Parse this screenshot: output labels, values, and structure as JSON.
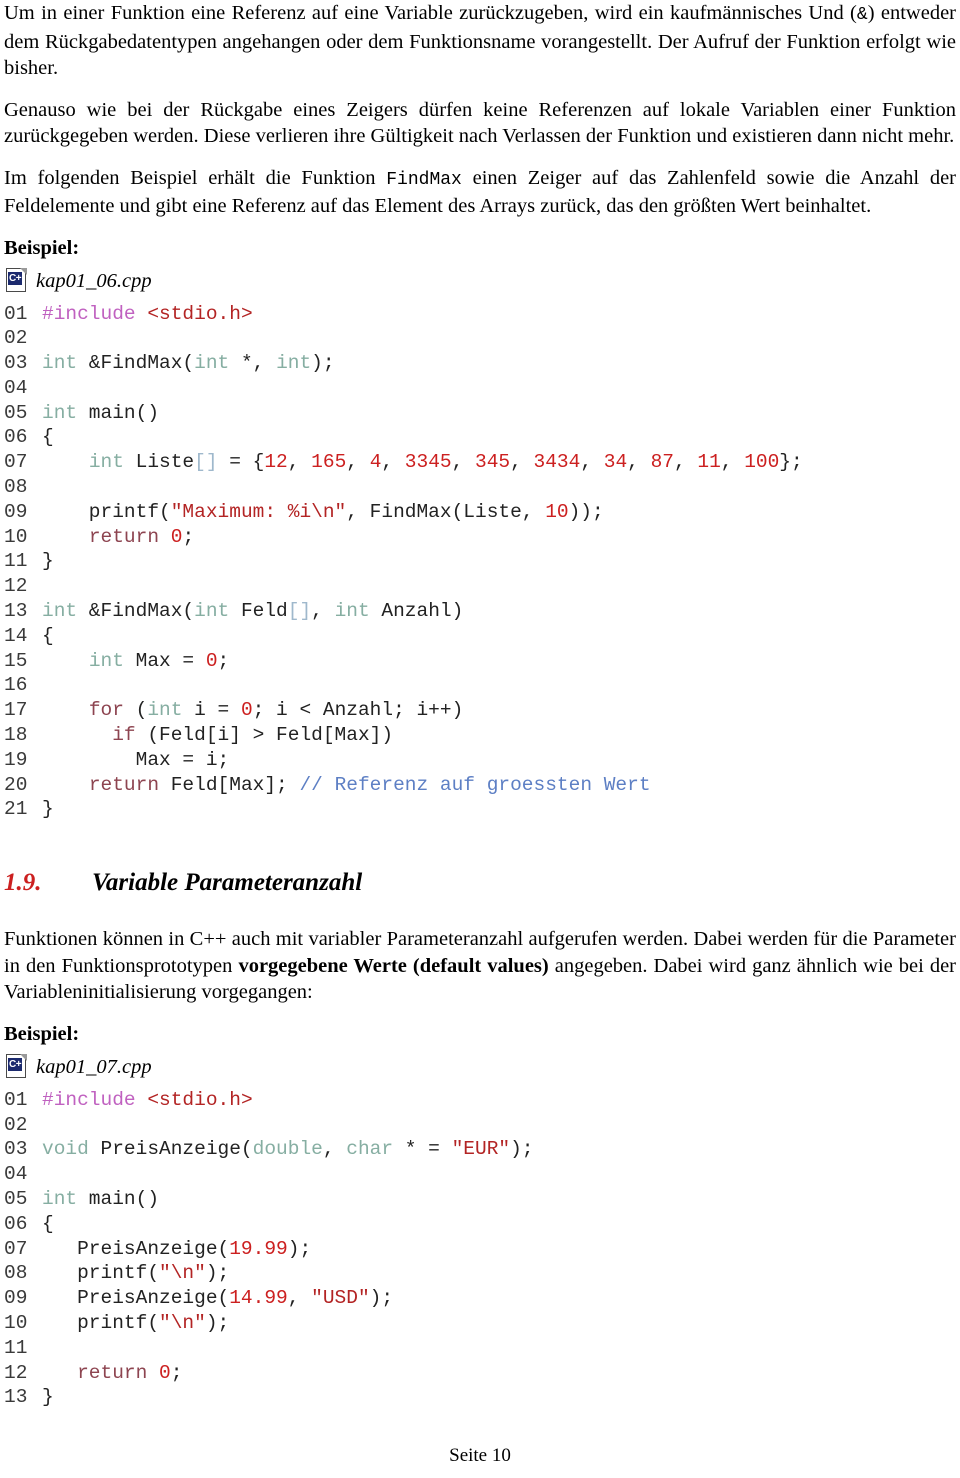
{
  "document": {
    "language": "de",
    "page_footer": "Seite 10"
  },
  "colors": {
    "text": "#000000",
    "code_default": "#222222",
    "line_number": "#3a3a3a",
    "keyword": "#8d4450",
    "type": "#86aea2",
    "preprocessor": "#c061c0",
    "string": "#b32424",
    "number": "#cc2020",
    "comment": "#5d7fc4",
    "icon_badge": "#1c2a6e"
  },
  "paragraphs": {
    "p1_part1": "Um in einer Funktion eine Referenz auf eine Variable zurückzugeben, wird ein kaufmännisches Und (",
    "p1_amp": "&",
    "p1_part2": ") entweder dem Rückgabedatentypen angehangen oder dem Funktionsname vorangestellt. Der Aufruf der Funktion erfolgt wie bisher.",
    "p2": "Genauso wie bei der Rückgabe eines Zeigers dürfen keine Referenzen auf lokale Variablen einer Funktion zurückgegeben werden. Diese verlieren ihre Gültigkeit nach Verlassen der Funktion und existieren dann nicht mehr.",
    "p3_part1": "Im folgenden Beispiel erhält die Funktion ",
    "p3_code": "FindMax",
    "p3_part2": " einen Zeiger auf das Zahlenfeld sowie die Anzahl der Feldelemente und gibt eine Referenz auf das Element des Arrays zurück, das den größten Wert beinhaltet.",
    "p4_part1": "Funktionen können in C++ auch mit variabler Parameteranzahl aufgerufen werden. Dabei werden für die Parameter in den Funktionsprototypen ",
    "p4_bold": "vorgegebene Werte (default values)",
    "p4_part2": " angegeben. Dabei wird ganz ähnlich wie bei der Variableninitialisierung vorgegangen:"
  },
  "labels": {
    "beispiel_1": "Beispiel:",
    "beispiel_2": "Beispiel:"
  },
  "section": {
    "number": "1.9.",
    "title": "Variable Parameteranzahl"
  },
  "listing1": {
    "icon": "cpp-file-icon",
    "icon_badge_text": "C+",
    "filename": "kap01_06.cpp",
    "lines": [
      {
        "n": "01",
        "tokens": [
          {
            "t": "#include ",
            "c": "pre"
          },
          {
            "t": "<stdio.h>",
            "c": "str"
          }
        ]
      },
      {
        "n": "02",
        "tokens": []
      },
      {
        "n": "03",
        "tokens": [
          {
            "t": "int",
            "c": "type"
          },
          {
            "t": " &FindMax(",
            "c": "plain"
          },
          {
            "t": "int",
            "c": "type"
          },
          {
            "t": " *, ",
            "c": "plain"
          },
          {
            "t": "int",
            "c": "type"
          },
          {
            "t": ");",
            "c": "plain"
          }
        ]
      },
      {
        "n": "04",
        "tokens": []
      },
      {
        "n": "05",
        "tokens": [
          {
            "t": "int",
            "c": "type"
          },
          {
            "t": " main()",
            "c": "plain"
          }
        ]
      },
      {
        "n": "06",
        "tokens": [
          {
            "t": "{",
            "c": "plain"
          }
        ]
      },
      {
        "n": "07",
        "tokens": [
          {
            "t": "    ",
            "c": "plain"
          },
          {
            "t": "int",
            "c": "type"
          },
          {
            "t": " Liste",
            "c": "plain"
          },
          {
            "t": "[]",
            "c": "pun"
          },
          {
            "t": " = {",
            "c": "plain"
          },
          {
            "t": "12",
            "c": "num"
          },
          {
            "t": ", ",
            "c": "plain"
          },
          {
            "t": "165",
            "c": "num"
          },
          {
            "t": ", ",
            "c": "plain"
          },
          {
            "t": "4",
            "c": "num"
          },
          {
            "t": ", ",
            "c": "plain"
          },
          {
            "t": "3345",
            "c": "num"
          },
          {
            "t": ", ",
            "c": "plain"
          },
          {
            "t": "345",
            "c": "num"
          },
          {
            "t": ", ",
            "c": "plain"
          },
          {
            "t": "3434",
            "c": "num"
          },
          {
            "t": ", ",
            "c": "plain"
          },
          {
            "t": "34",
            "c": "num"
          },
          {
            "t": ", ",
            "c": "plain"
          },
          {
            "t": "87",
            "c": "num"
          },
          {
            "t": ", ",
            "c": "plain"
          },
          {
            "t": "11",
            "c": "num"
          },
          {
            "t": ", ",
            "c": "plain"
          },
          {
            "t": "100",
            "c": "num"
          },
          {
            "t": "};",
            "c": "plain"
          }
        ]
      },
      {
        "n": "08",
        "tokens": []
      },
      {
        "n": "09",
        "tokens": [
          {
            "t": "    printf(",
            "c": "plain"
          },
          {
            "t": "\"Maximum: %i\\n\"",
            "c": "str"
          },
          {
            "t": ", FindMax(Liste, ",
            "c": "plain"
          },
          {
            "t": "10",
            "c": "num"
          },
          {
            "t": "));",
            "c": "plain"
          }
        ]
      },
      {
        "n": "10",
        "tokens": [
          {
            "t": "    ",
            "c": "plain"
          },
          {
            "t": "return",
            "c": "kw"
          },
          {
            "t": " ",
            "c": "plain"
          },
          {
            "t": "0",
            "c": "num"
          },
          {
            "t": ";",
            "c": "plain"
          }
        ]
      },
      {
        "n": "11",
        "tokens": [
          {
            "t": "}",
            "c": "plain"
          }
        ]
      },
      {
        "n": "12",
        "tokens": []
      },
      {
        "n": "13",
        "tokens": [
          {
            "t": "int",
            "c": "type"
          },
          {
            "t": " &FindMax(",
            "c": "plain"
          },
          {
            "t": "int",
            "c": "type"
          },
          {
            "t": " Feld",
            "c": "plain"
          },
          {
            "t": "[]",
            "c": "pun"
          },
          {
            "t": ", ",
            "c": "plain"
          },
          {
            "t": "int",
            "c": "type"
          },
          {
            "t": " Anzahl)",
            "c": "plain"
          }
        ]
      },
      {
        "n": "14",
        "tokens": [
          {
            "t": "{",
            "c": "plain"
          }
        ]
      },
      {
        "n": "15",
        "tokens": [
          {
            "t": "    ",
            "c": "plain"
          },
          {
            "t": "int",
            "c": "type"
          },
          {
            "t": " Max = ",
            "c": "plain"
          },
          {
            "t": "0",
            "c": "num"
          },
          {
            "t": ";",
            "c": "plain"
          }
        ]
      },
      {
        "n": "16",
        "tokens": []
      },
      {
        "n": "17",
        "tokens": [
          {
            "t": "    ",
            "c": "plain"
          },
          {
            "t": "for",
            "c": "kw"
          },
          {
            "t": " (",
            "c": "plain"
          },
          {
            "t": "int",
            "c": "type"
          },
          {
            "t": " i = ",
            "c": "plain"
          },
          {
            "t": "0",
            "c": "num"
          },
          {
            "t": "; i < Anzahl; i++)",
            "c": "plain"
          }
        ]
      },
      {
        "n": "18",
        "tokens": [
          {
            "t": "      ",
            "c": "plain"
          },
          {
            "t": "if",
            "c": "kw"
          },
          {
            "t": " (Feld[i] > Feld[Max])",
            "c": "plain"
          }
        ]
      },
      {
        "n": "19",
        "tokens": [
          {
            "t": "        Max = i;",
            "c": "plain"
          }
        ]
      },
      {
        "n": "20",
        "tokens": [
          {
            "t": "    ",
            "c": "plain"
          },
          {
            "t": "return",
            "c": "kw"
          },
          {
            "t": " Feld[Max]; ",
            "c": "plain"
          },
          {
            "t": "// Referenz auf groessten Wert",
            "c": "com"
          }
        ]
      },
      {
        "n": "21",
        "tokens": [
          {
            "t": "}",
            "c": "plain"
          }
        ]
      }
    ]
  },
  "listing2": {
    "icon": "cpp-file-icon",
    "icon_badge_text": "C+",
    "filename": "kap01_07.cpp",
    "lines": [
      {
        "n": "01",
        "tokens": [
          {
            "t": "#include ",
            "c": "pre"
          },
          {
            "t": "<stdio.h>",
            "c": "str"
          }
        ]
      },
      {
        "n": "02",
        "tokens": []
      },
      {
        "n": "03",
        "tokens": [
          {
            "t": "void",
            "c": "type"
          },
          {
            "t": " PreisAnzeige(",
            "c": "plain"
          },
          {
            "t": "double",
            "c": "type"
          },
          {
            "t": ", ",
            "c": "plain"
          },
          {
            "t": "char",
            "c": "type"
          },
          {
            "t": " * = ",
            "c": "plain"
          },
          {
            "t": "\"EUR\"",
            "c": "str"
          },
          {
            "t": ");",
            "c": "plain"
          }
        ]
      },
      {
        "n": "04",
        "tokens": []
      },
      {
        "n": "05",
        "tokens": [
          {
            "t": "int",
            "c": "type"
          },
          {
            "t": " main()",
            "c": "plain"
          }
        ]
      },
      {
        "n": "06",
        "tokens": [
          {
            "t": "{",
            "c": "plain"
          }
        ]
      },
      {
        "n": "07",
        "tokens": [
          {
            "t": "   PreisAnzeige(",
            "c": "plain"
          },
          {
            "t": "19.99",
            "c": "num"
          },
          {
            "t": ");",
            "c": "plain"
          }
        ]
      },
      {
        "n": "08",
        "tokens": [
          {
            "t": "   printf(",
            "c": "plain"
          },
          {
            "t": "\"\\n\"",
            "c": "str"
          },
          {
            "t": ");",
            "c": "plain"
          }
        ]
      },
      {
        "n": "09",
        "tokens": [
          {
            "t": "   PreisAnzeige(",
            "c": "plain"
          },
          {
            "t": "14.99",
            "c": "num"
          },
          {
            "t": ", ",
            "c": "plain"
          },
          {
            "t": "\"USD\"",
            "c": "str"
          },
          {
            "t": ");",
            "c": "plain"
          }
        ]
      },
      {
        "n": "10",
        "tokens": [
          {
            "t": "   printf(",
            "c": "plain"
          },
          {
            "t": "\"\\n\"",
            "c": "str"
          },
          {
            "t": ");",
            "c": "plain"
          }
        ]
      },
      {
        "n": "11",
        "tokens": []
      },
      {
        "n": "12",
        "tokens": [
          {
            "t": "   ",
            "c": "plain"
          },
          {
            "t": "return",
            "c": "kw"
          },
          {
            "t": " ",
            "c": "plain"
          },
          {
            "t": "0",
            "c": "num"
          },
          {
            "t": ";",
            "c": "plain"
          }
        ]
      },
      {
        "n": "13",
        "tokens": [
          {
            "t": "}",
            "c": "plain"
          }
        ]
      }
    ]
  }
}
